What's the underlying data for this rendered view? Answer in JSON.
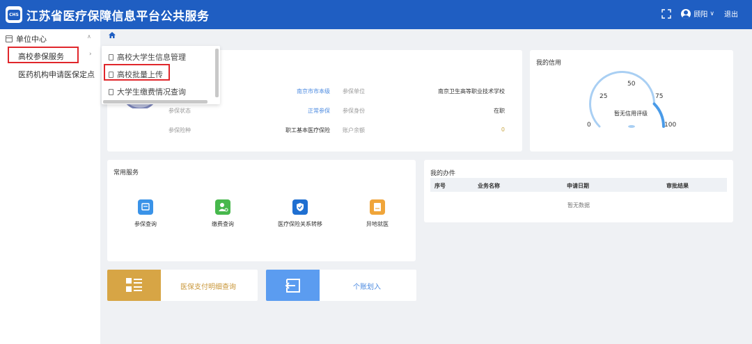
{
  "header": {
    "title": "江苏省医疗保障信息平台公共服务",
    "logo_text": "CHS",
    "user_name": "顾阳",
    "logout_label": "退出"
  },
  "sidebar": {
    "head_label": "单位中心",
    "items": [
      {
        "label": "高校参保服务"
      },
      {
        "label": "医药机构申请医保定点"
      }
    ]
  },
  "flyout": {
    "items": [
      {
        "label": "高校大学生信息管理"
      },
      {
        "label": "高校批量上传"
      },
      {
        "label": "大学生缴费情况查询"
      }
    ]
  },
  "insured_info": {
    "fields": [
      {
        "label": "",
        "value": "南京市市本级"
      },
      {
        "label": "参保单位",
        "value": "南京卫生高等职业技术学校"
      },
      {
        "label": "参保状态",
        "value": "正常参保"
      },
      {
        "label": "参保身份",
        "value": "在职"
      },
      {
        "label": "参保险种",
        "value": "职工基本医疗保险"
      },
      {
        "label": "账户余额",
        "value": "0"
      }
    ]
  },
  "credit": {
    "title": "我的信用",
    "scale": [
      "0",
      "25",
      "50",
      "75",
      "100"
    ],
    "center_text": "暂无信用评级",
    "score_fraction": 0.75
  },
  "services": {
    "title": "常用服务",
    "items": [
      {
        "label": "参保查询",
        "icon": "insurance-query-icon",
        "color": "#3a93e8"
      },
      {
        "label": "缴费查询",
        "icon": "payment-query-icon",
        "color": "#47b84c"
      },
      {
        "label": "医疗保险关系转移",
        "icon": "shield-transfer-icon",
        "color": "#1f6fd1"
      },
      {
        "label": "异地就医",
        "icon": "remote-medical-icon",
        "color": "#f0a53a"
      }
    ]
  },
  "my_tasks": {
    "title": "我的办件",
    "columns": [
      "序号",
      "业务名称",
      "申请日期",
      "审批结果"
    ],
    "empty_text": "暂无数据"
  },
  "quick": {
    "items": [
      {
        "label": "医保支付明细查询",
        "icon_color": "#d7a545",
        "text_color": "#c9973a"
      },
      {
        "label": "个账划入",
        "icon_color": "#5b9cf0",
        "text_color": "#4d8be0"
      }
    ]
  }
}
